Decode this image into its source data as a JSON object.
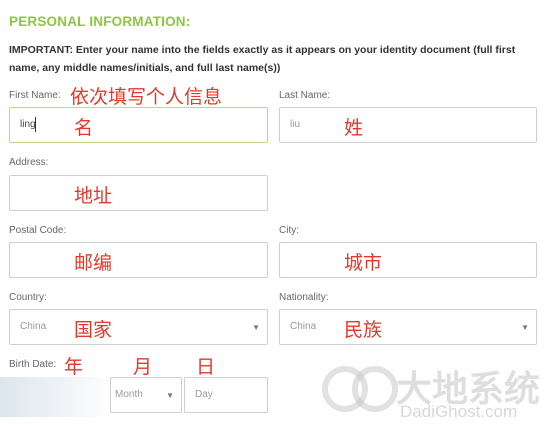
{
  "section_title": "PERSONAL INFORMATION:",
  "important_note": "IMPORTANT: Enter your name into the fields exactly as it appears on your identity document (full first name, any middle names/initials, and full last name(s))",
  "fields": {
    "first_name": {
      "label": "First Name:",
      "value": "ling",
      "annotation": "名"
    },
    "last_name": {
      "label": "Last Name:",
      "value": "liu",
      "annotation": "姓"
    },
    "address": {
      "label": "Address:",
      "value": "",
      "annotation": "地址"
    },
    "postal_code": {
      "label": "Postal Code:",
      "value": "",
      "annotation": "邮编"
    },
    "city": {
      "label": "City:",
      "value": "",
      "annotation": "城市"
    },
    "country": {
      "label": "Country:",
      "selected": "China",
      "annotation": "国家"
    },
    "nationality": {
      "label": "Nationality:",
      "selected": "China",
      "annotation": "民族"
    },
    "birth_date": {
      "label": "Birth Date:",
      "month_placeholder": "Month",
      "day_placeholder": "Day",
      "annotations": {
        "year": "年",
        "month": "月",
        "day": "日"
      }
    }
  },
  "annotations": {
    "name_instruction": "依次填写个人信息"
  },
  "watermark": {
    "cn": "大地系统",
    "en": "DadiGhost.com",
    "logo_letters": "dd"
  },
  "colors": {
    "accent_green": "#8cc63f",
    "annotation_red": "#e03a2c",
    "focus_border": "#b9dc7f"
  },
  "icons": {
    "select_arrow": "chevron-down-icon"
  }
}
